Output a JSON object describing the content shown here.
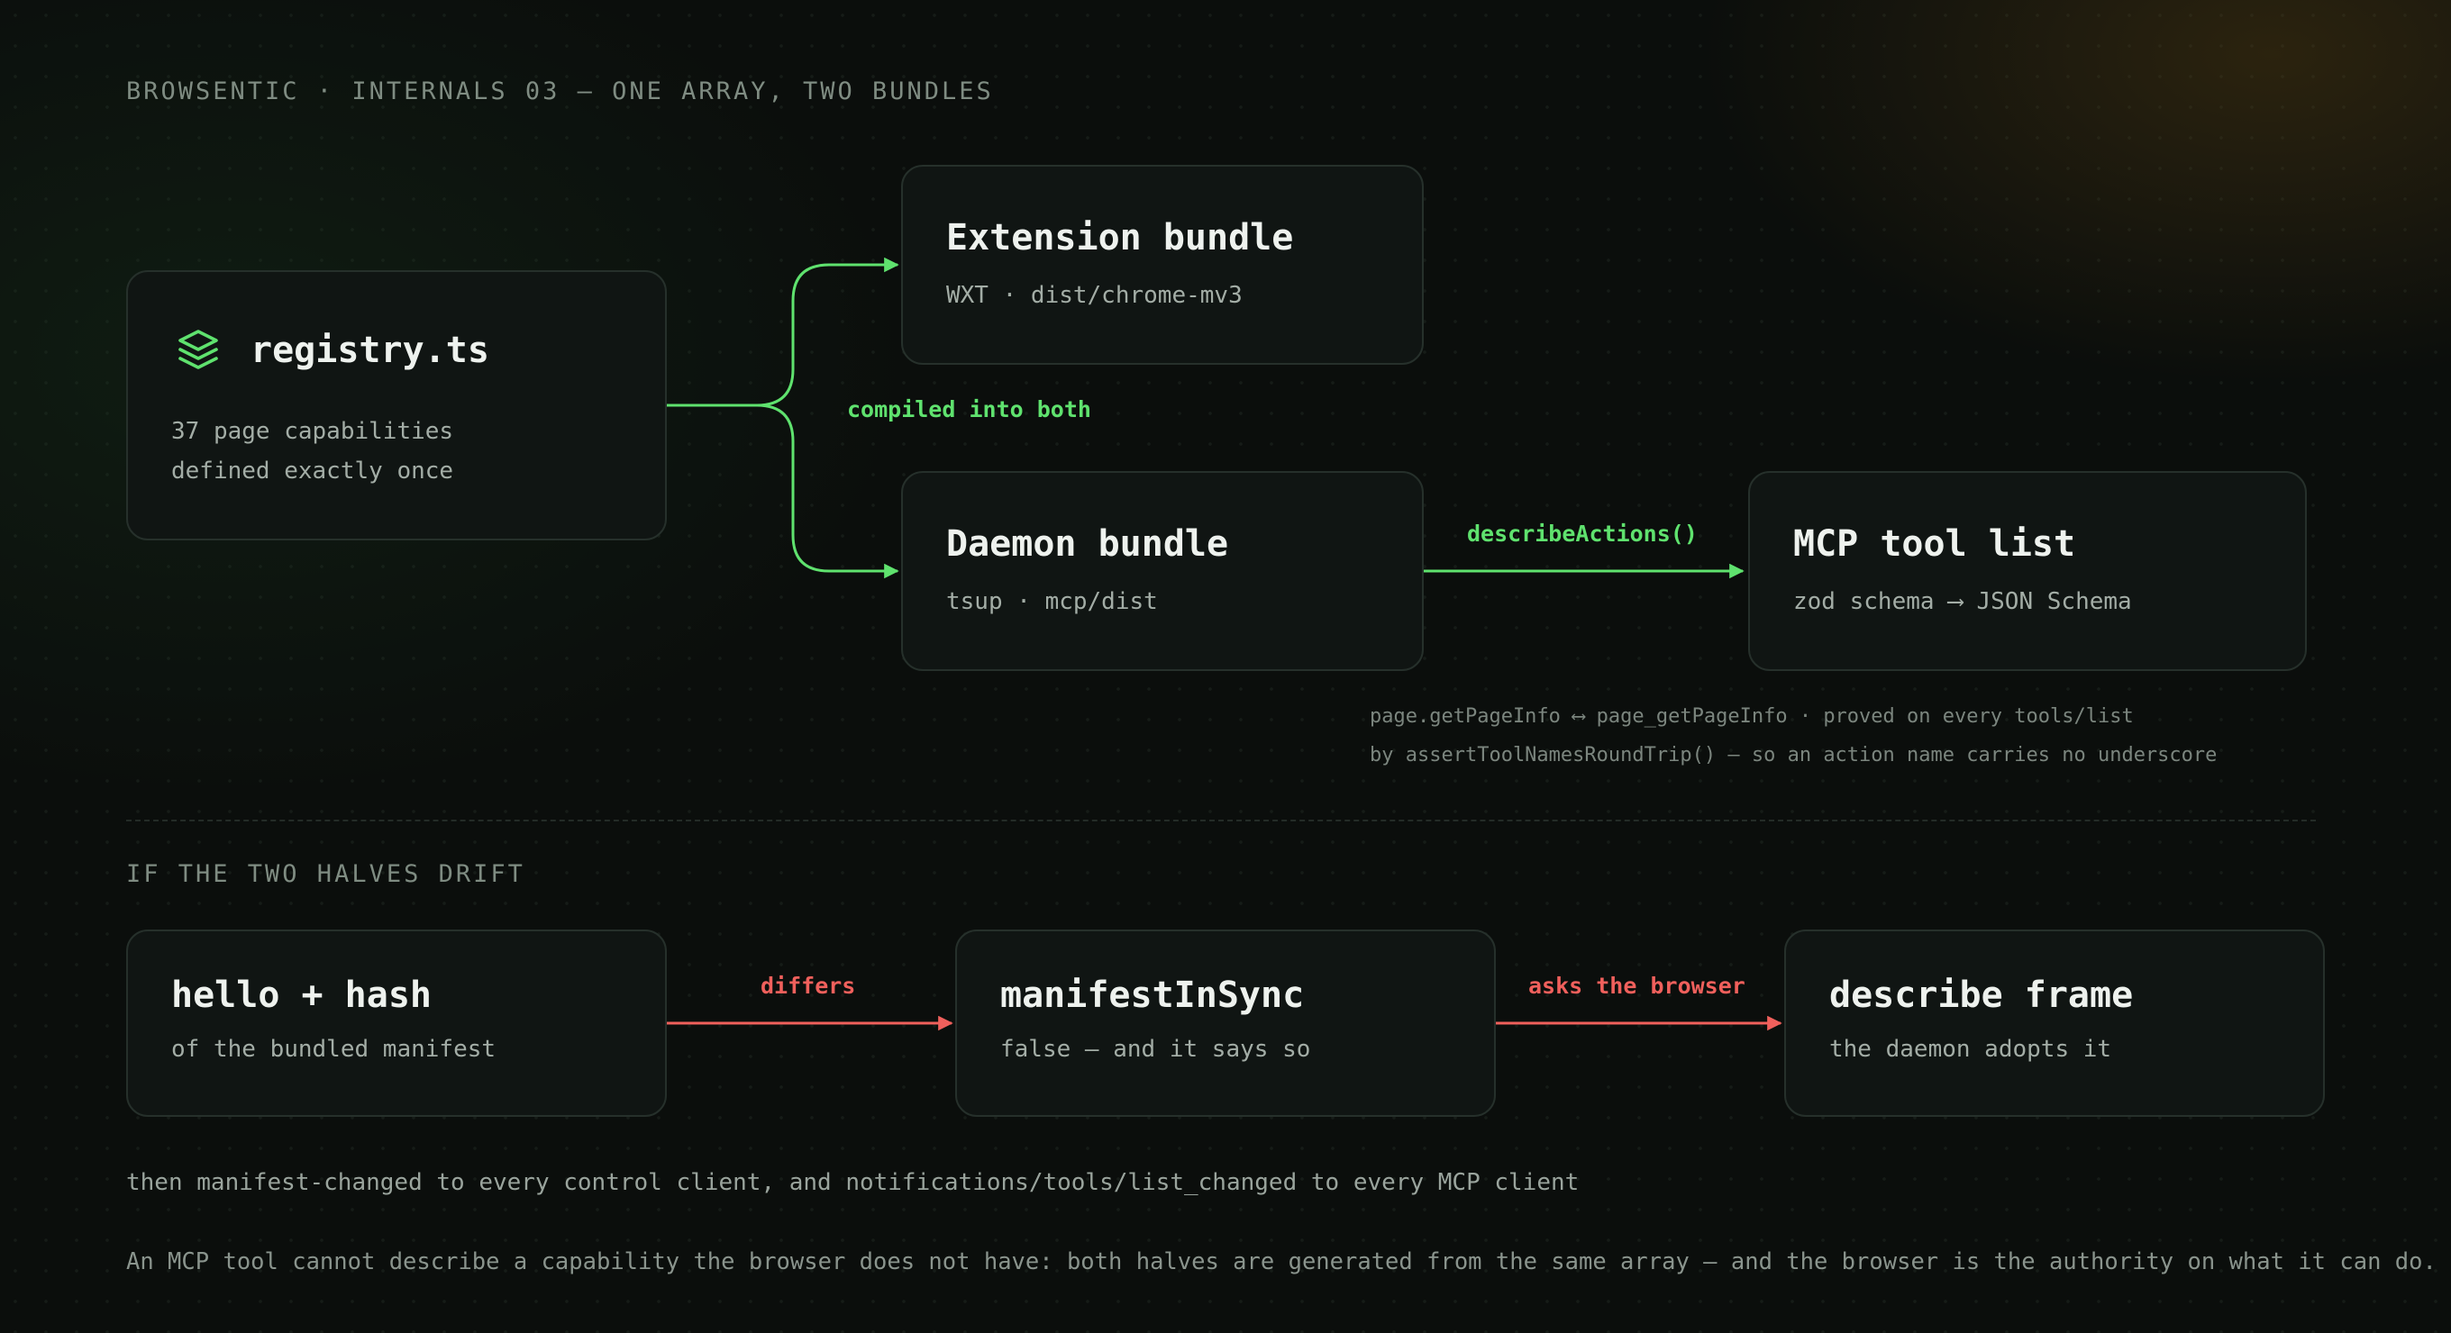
{
  "header": {
    "caption": "BROWSENTIC · INTERNALS 03 — ONE ARRAY, TWO BUNDLES"
  },
  "colors": {
    "accent_green": "#5fe26e",
    "alert_red": "#f0605c",
    "node_bg": "#101513",
    "node_border": "#26302b"
  },
  "top_flow": {
    "registry": {
      "icon": "layers-icon",
      "title": "registry.ts",
      "line1": "37 page capabilities",
      "line2": "defined exactly once"
    },
    "extension": {
      "title": "Extension bundle",
      "subtitle": "WXT · dist/chrome-mv3"
    },
    "daemon": {
      "title": "Daemon bundle",
      "subtitle": "tsup · mcp/dist"
    },
    "mcp": {
      "title": "MCP tool list",
      "subtitle": "zod schema ⟶ JSON Schema"
    },
    "edge_compiled": "compiled into both",
    "edge_describe": "describeActions()",
    "note_line1": "page.getPageInfo ⟷ page_getPageInfo · proved on every tools/list",
    "note_line2": "by assertToolNamesRoundTrip() — so an action name carries no underscore"
  },
  "drift": {
    "caption": "IF THE TWO HALVES DRIFT",
    "hello": {
      "title": "hello + hash",
      "subtitle": "of the bundled manifest"
    },
    "manifest": {
      "title": "manifestInSync",
      "subtitle": "false — and it says so"
    },
    "describe": {
      "title": "describe frame",
      "subtitle": "the daemon adopts it"
    },
    "edge_differs": "differs",
    "edge_asks": "asks the browser"
  },
  "footer": {
    "line1": "then manifest-changed to every control client, and notifications/tools/list_changed to every MCP client",
    "line2": "An MCP tool cannot describe a capability the browser does not have: both halves are generated from the same array — and the browser is the authority on what it can do."
  }
}
